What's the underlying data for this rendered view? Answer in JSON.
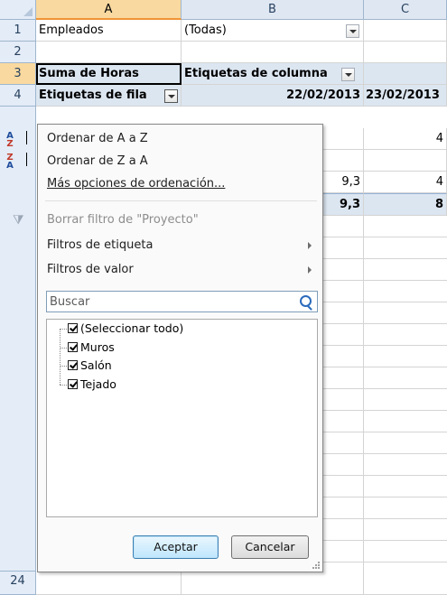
{
  "sheet": {
    "columns": [
      "A",
      "B",
      "C"
    ],
    "rows": {
      "r1": {
        "num": "1",
        "a": "Empleados",
        "b": "(Todas)"
      },
      "r2": {
        "num": "2"
      },
      "r3": {
        "num": "3",
        "a": "Suma de Horas",
        "b": "Etiquetas de columna"
      },
      "r4": {
        "num": "4",
        "a": "Etiquetas de fila",
        "b": "22/02/2013",
        "c": "23/02/2013"
      },
      "r24": {
        "num": "24"
      }
    },
    "visible_values": {
      "c5": "4",
      "b7": "9,3",
      "c7": "4",
      "b8": "9,3",
      "c8": "8"
    }
  },
  "menu": {
    "sort_az": "Ordenar de A a Z",
    "sort_za": "Ordenar de Z a A",
    "more_sort": "Más opciones de ordenación...",
    "clear_filter": "Borrar filtro de \"Proyecto\"",
    "label_filters": "Filtros de etiqueta",
    "value_filters": "Filtros de valor",
    "search_placeholder": "Buscar",
    "items": [
      {
        "label": "(Seleccionar todo)",
        "checked": true
      },
      {
        "label": "Muros",
        "checked": true
      },
      {
        "label": "Salón",
        "checked": true
      },
      {
        "label": "Tejado",
        "checked": true
      }
    ],
    "ok": "Aceptar",
    "cancel": "Cancelar"
  },
  "icons": {
    "sort_az": "sort-az-icon",
    "sort_za": "sort-za-icon",
    "clear_filter": "clear-filter-icon",
    "search": "search-icon"
  },
  "colors": {
    "pivot_fill": "#dce6f1",
    "selected_header": "#f9d99f",
    "accent": "#2b6bbd"
  }
}
